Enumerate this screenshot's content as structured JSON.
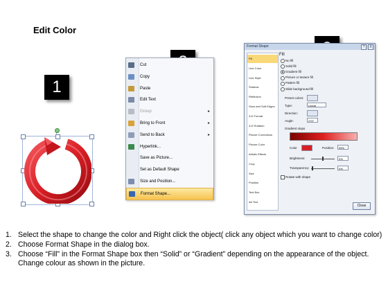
{
  "title": "Edit Color",
  "badges": [
    "1",
    "2",
    "3"
  ],
  "colors": {
    "ring_red": "#d81f26",
    "highlight": "#f6c24f",
    "dialog_bg": "#eef1f6"
  },
  "context_menu": {
    "items": [
      {
        "label": "Cut",
        "icon": "scissors-icon"
      },
      {
        "label": "Copy",
        "icon": "copy-icon"
      },
      {
        "label": "Paste",
        "icon": "paste-icon"
      },
      {
        "label": "Edit Text",
        "icon": "edit-text-icon"
      },
      {
        "label": "Group",
        "icon": "group-icon",
        "disabled": true,
        "submenu": true
      },
      {
        "label": "Bring to Front",
        "icon": "bring-front-icon",
        "submenu": true
      },
      {
        "label": "Send to Back",
        "icon": "send-back-icon",
        "submenu": true
      },
      {
        "label": "Hyperlink...",
        "icon": "hyperlink-icon"
      },
      {
        "label": "Save as Picture...",
        "icon": ""
      },
      {
        "label": "Set as Default Shape",
        "icon": ""
      },
      {
        "label": "Size and Position...",
        "icon": "size-position-icon"
      },
      {
        "label": "Format Shape...",
        "icon": "format-shape-icon",
        "highlighted": true
      }
    ]
  },
  "dialog": {
    "title": "Format Shape",
    "help": "?",
    "close_x": "X",
    "categories": [
      "Fill",
      "Line Color",
      "Line Style",
      "Shadow",
      "Reflection",
      "Glow and Soft Edges",
      "3-D Format",
      "3-D Rotation",
      "Picture Corrections",
      "Picture Color",
      "Artistic Effects",
      "Crop",
      "Size",
      "Position",
      "Text Box",
      "Alt Text"
    ],
    "section": "Fill",
    "options": [
      "No fill",
      "Solid fill",
      "Gradient fill",
      "Picture or texture fill",
      "Pattern fill",
      "Slide background fill"
    ],
    "selected_option": "Gradient fill",
    "labels": {
      "preset": "Preset colors:",
      "type": "Type:",
      "type_value": "Linear",
      "direction": "Direction:",
      "angle": "Angle:",
      "angle_value": "270°",
      "stops": "Gradient stops",
      "color": "Color",
      "position": "Position:",
      "position_value": "99%",
      "brightness": "Brightness:",
      "brightness_value": "0%",
      "transparency": "Transparency:",
      "transparency_value": "0%",
      "rotate": "Rotate with shape"
    },
    "close_button": "Close"
  },
  "steps": [
    {
      "num": "1.",
      "text": "Select the shape to change the color and Right click the object( click any object which you want to change color)"
    },
    {
      "num": "2.",
      "text": "Choose Format Shape in the dialog box."
    },
    {
      "num": "3.",
      "text": "Choose “Fill” in the Format Shape box then “Solid” or “Gradient” depending on the appearance of the object. Change colour as shown in the picture."
    }
  ]
}
